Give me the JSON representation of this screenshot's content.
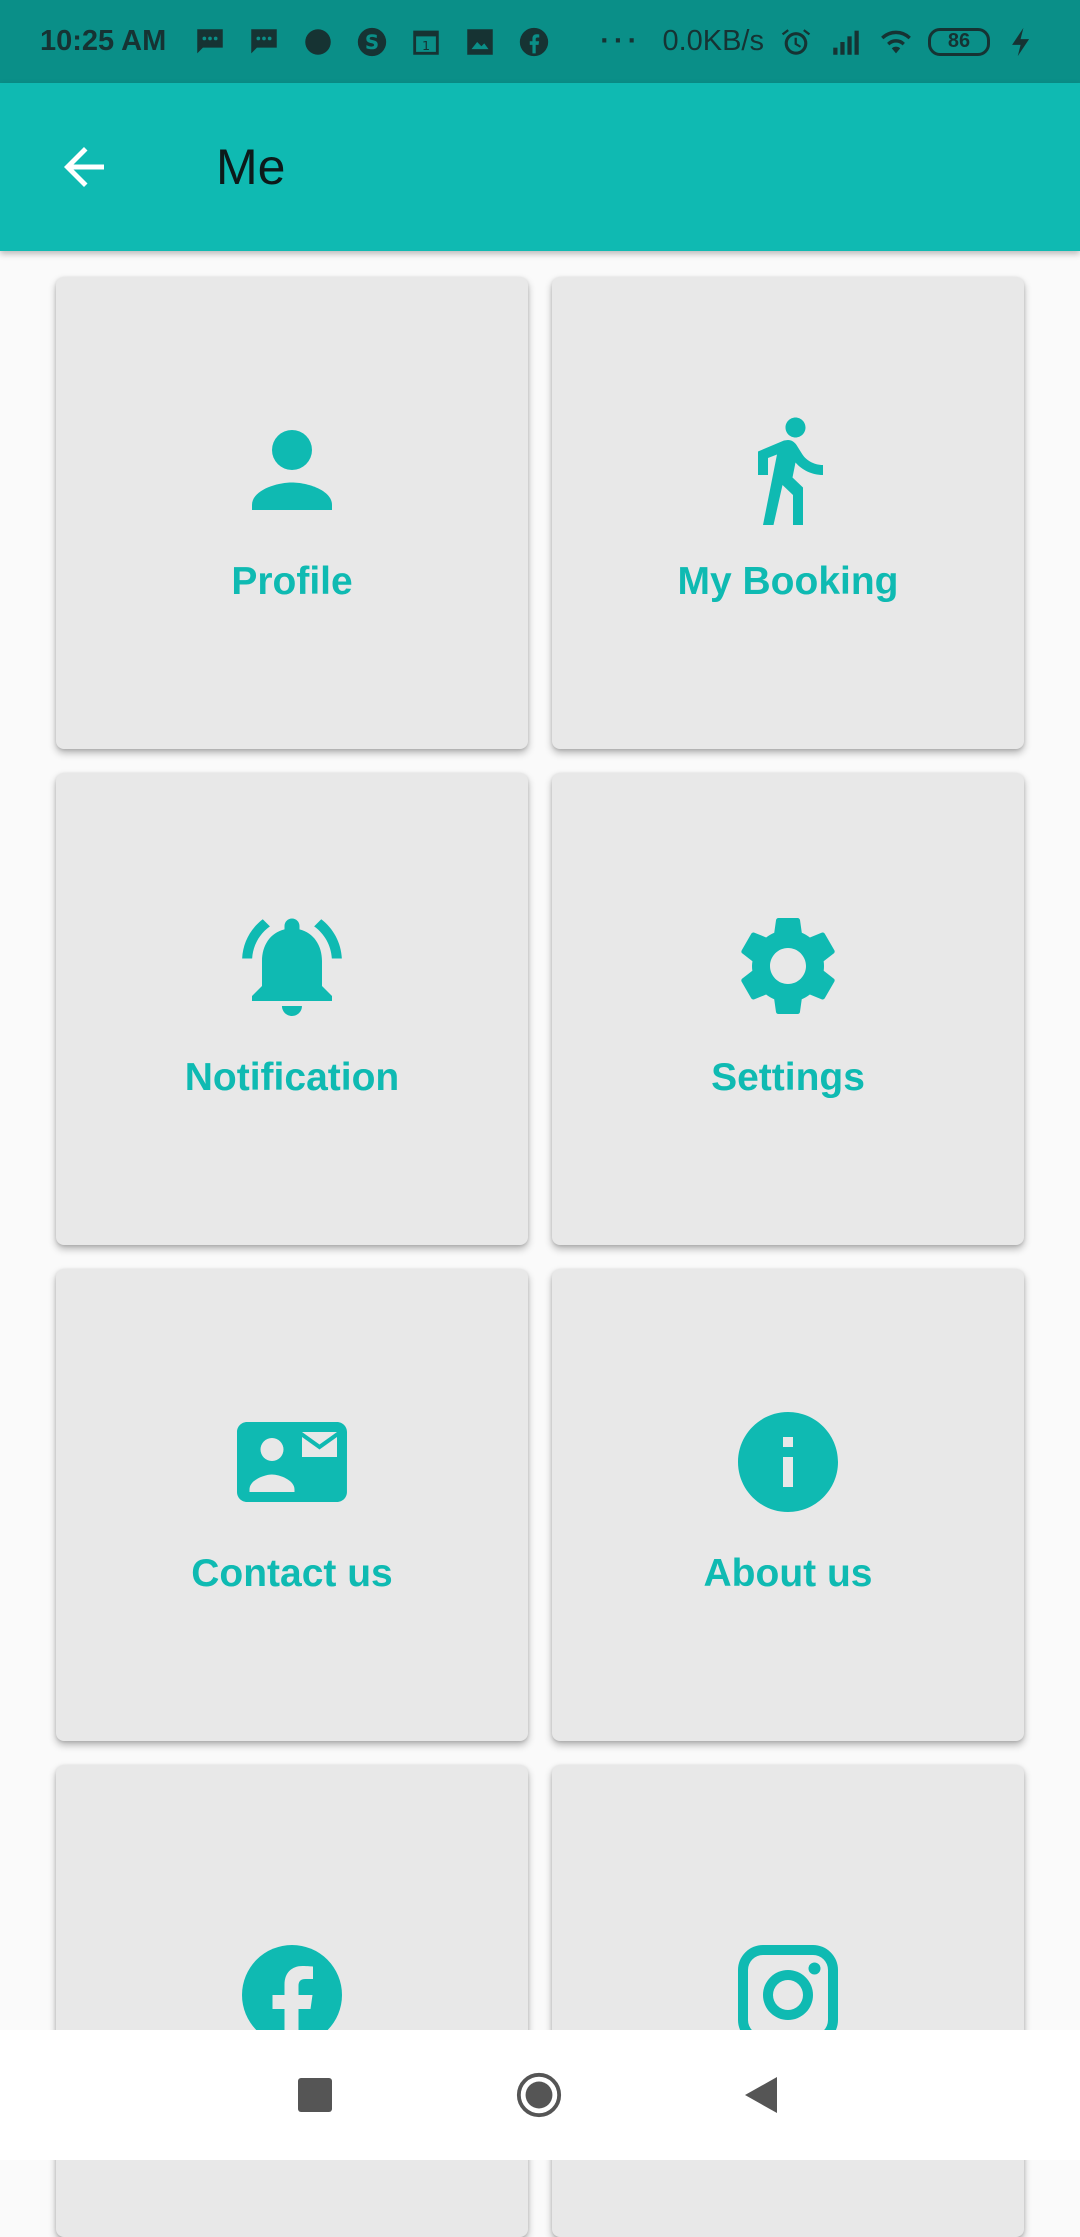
{
  "status_bar": {
    "time": "10:25 AM",
    "net_speed": "0.0KB/s",
    "battery": "86",
    "overflow": "···",
    "icons": [
      "message-icon",
      "message-icon",
      "app-icon",
      "skype-icon",
      "calendar-icon",
      "gallery-icon",
      "facebook-icon",
      "alarm-icon",
      "signal-icon",
      "wifi-icon",
      "battery-icon",
      "charging-icon"
    ]
  },
  "app_bar": {
    "title": "Me",
    "back_icon": "arrow-back-icon"
  },
  "colors": {
    "accent": "#0fbab2",
    "status_bar_bg": "#0a8f88",
    "tile_bg": "#e8e8e8"
  },
  "tiles": [
    {
      "label": "Profile",
      "icon": "person-icon"
    },
    {
      "label": "My Booking",
      "icon": "running-person-icon"
    },
    {
      "label": "Notification",
      "icon": "bell-ringing-icon"
    },
    {
      "label": "Settings",
      "icon": "gear-icon"
    },
    {
      "label": "Contact us",
      "icon": "contact-card-icon"
    },
    {
      "label": "About us",
      "icon": "info-icon"
    },
    {
      "label": "",
      "icon": "facebook-icon"
    },
    {
      "label": "",
      "icon": "instagram-icon"
    }
  ],
  "nav_bar": {
    "icons": [
      "recents-square-icon",
      "home-circle-icon",
      "back-triangle-icon"
    ]
  }
}
